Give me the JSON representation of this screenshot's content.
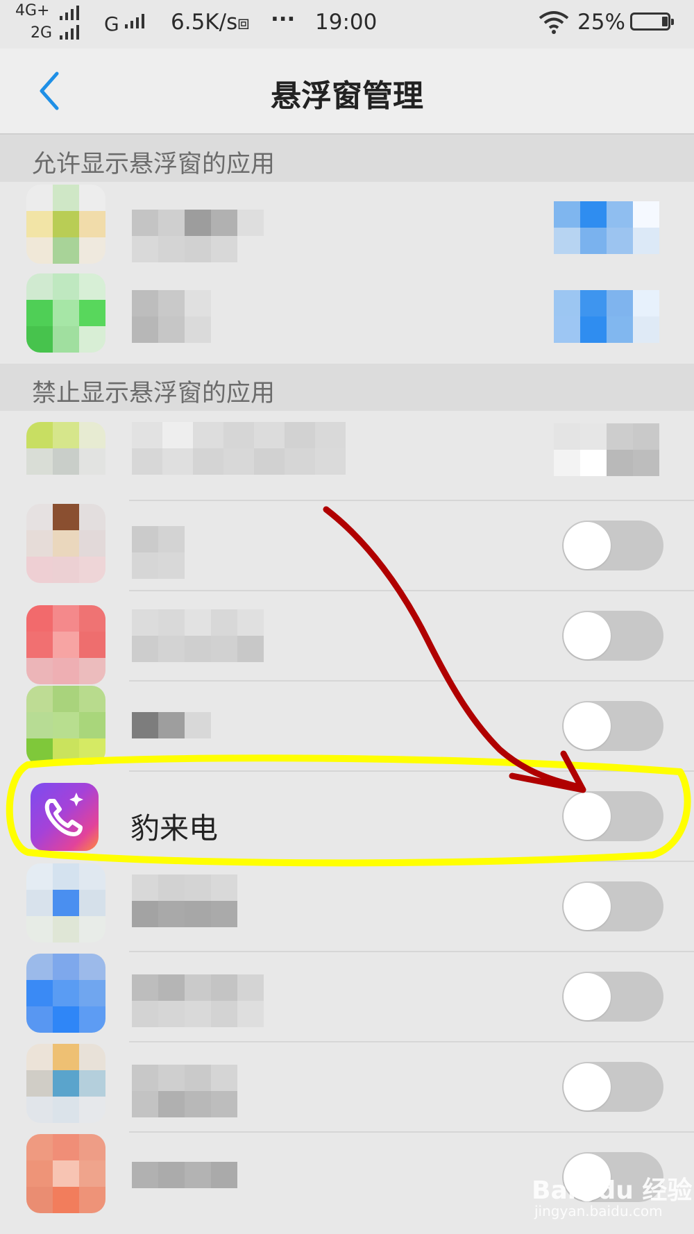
{
  "status_bar": {
    "net1": "4G+",
    "net2": "2G",
    "net3": "G",
    "speed": "6.5K/s",
    "dots": "···",
    "time": "19:00",
    "battery": "25%"
  },
  "nav": {
    "title": "悬浮窗管理"
  },
  "sections": {
    "allowed": "允许显示悬浮窗的应用",
    "blocked": "禁止显示悬浮窗的应用"
  },
  "highlighted_app": {
    "name": "豹来电",
    "toggle_on": false
  },
  "annotations": {
    "arrow_color": "#b00000",
    "highlight_color": "#ffff00"
  },
  "watermark": {
    "brand": "Bai●du 经验",
    "url": "jingyan.baidu.com"
  }
}
